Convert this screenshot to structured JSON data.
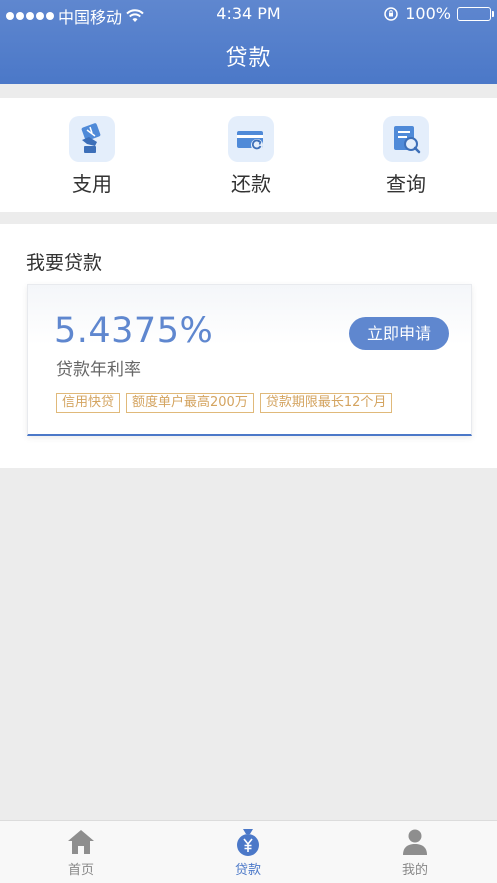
{
  "status_bar": {
    "carrier": "中国移动",
    "time": "4:34 PM",
    "battery": "100%"
  },
  "header": {
    "title": "贷款"
  },
  "actions": [
    {
      "label": "支用",
      "icon": "card-hand-icon"
    },
    {
      "label": "还款",
      "icon": "card-return-icon"
    },
    {
      "label": "查询",
      "icon": "document-search-icon"
    }
  ],
  "loan": {
    "section_title": "我要贷款",
    "rate": "5.4375%",
    "rate_label": "贷款年利率",
    "apply_label": "立即申请",
    "tags": [
      "信用快贷",
      "额度单户最高200万",
      "贷款期限最长12个月"
    ]
  },
  "tabbar": {
    "items": [
      {
        "label": "首页",
        "icon": "home-icon",
        "active": false
      },
      {
        "label": "贷款",
        "icon": "yuan-bag-icon",
        "active": true
      },
      {
        "label": "我的",
        "icon": "user-icon",
        "active": false
      }
    ]
  },
  "colors": {
    "primary": "#5f87cf",
    "accent_tag": "#d4a460",
    "background": "#ececec"
  }
}
